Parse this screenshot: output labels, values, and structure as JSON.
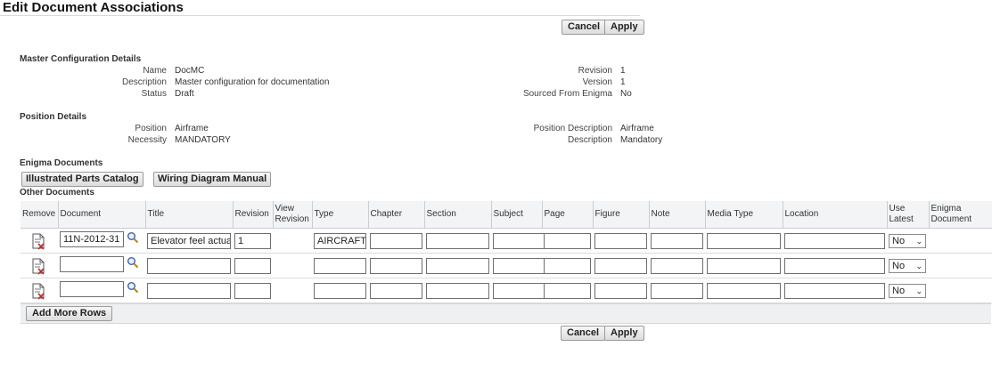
{
  "page_title": "Edit Document Associations",
  "buttons": {
    "cancel": "Cancel",
    "apply": "Apply",
    "add_more_rows": "Add More Rows"
  },
  "master": {
    "section_title": "Master Configuration Details",
    "name_label": "Name",
    "name": "DocMC",
    "description_label": "Description",
    "description": "Master configuration for documentation",
    "status_label": "Status",
    "status": "Draft",
    "revision_label": "Revision",
    "revision": "1",
    "version_label": "Version",
    "version": "1",
    "sourced_label": "Sourced From Enigma",
    "sourced": "No"
  },
  "position": {
    "section_title": "Position Details",
    "position_label": "Position",
    "position": "Airframe",
    "necessity_label": "Necessity",
    "necessity": "MANDATORY",
    "pos_desc_label": "Position Description",
    "pos_desc": "Airframe",
    "description_label": "Description",
    "description": "Mandatory"
  },
  "enigma": {
    "section_title": "Enigma Documents",
    "ipc_button": "Illustrated Parts Catalog",
    "wdm_button": "Wiring Diagram Manual"
  },
  "other_documents": {
    "section_title": "Other Documents",
    "headers": {
      "remove": "Remove",
      "document": "Document",
      "title": "Title",
      "revision": "Revision",
      "view_revision_1": "View",
      "view_revision_2": "Revision",
      "type": "Type",
      "chapter": "Chapter",
      "section": "Section",
      "subject": "Subject",
      "page": "Page",
      "figure": "Figure",
      "note": "Note",
      "media_type": "Media Type",
      "location": "Location",
      "use_latest_1": "Use",
      "use_latest_2": "Latest",
      "enigma_document_1": "Enigma",
      "enigma_document_2": "Document"
    },
    "rows": [
      {
        "document": "11N-2012-31",
        "title": "Elevator feel actua",
        "revision": "1",
        "type": "AIRCRAFT",
        "use_latest": "No"
      },
      {
        "document": "",
        "title": "",
        "revision": "",
        "type": "",
        "use_latest": "No"
      },
      {
        "document": "",
        "title": "",
        "revision": "",
        "type": "",
        "use_latest": "No"
      }
    ]
  },
  "icons": {
    "remove": "remove-document-icon",
    "search": "search-icon",
    "dropdown": "chevron-down-icon"
  }
}
